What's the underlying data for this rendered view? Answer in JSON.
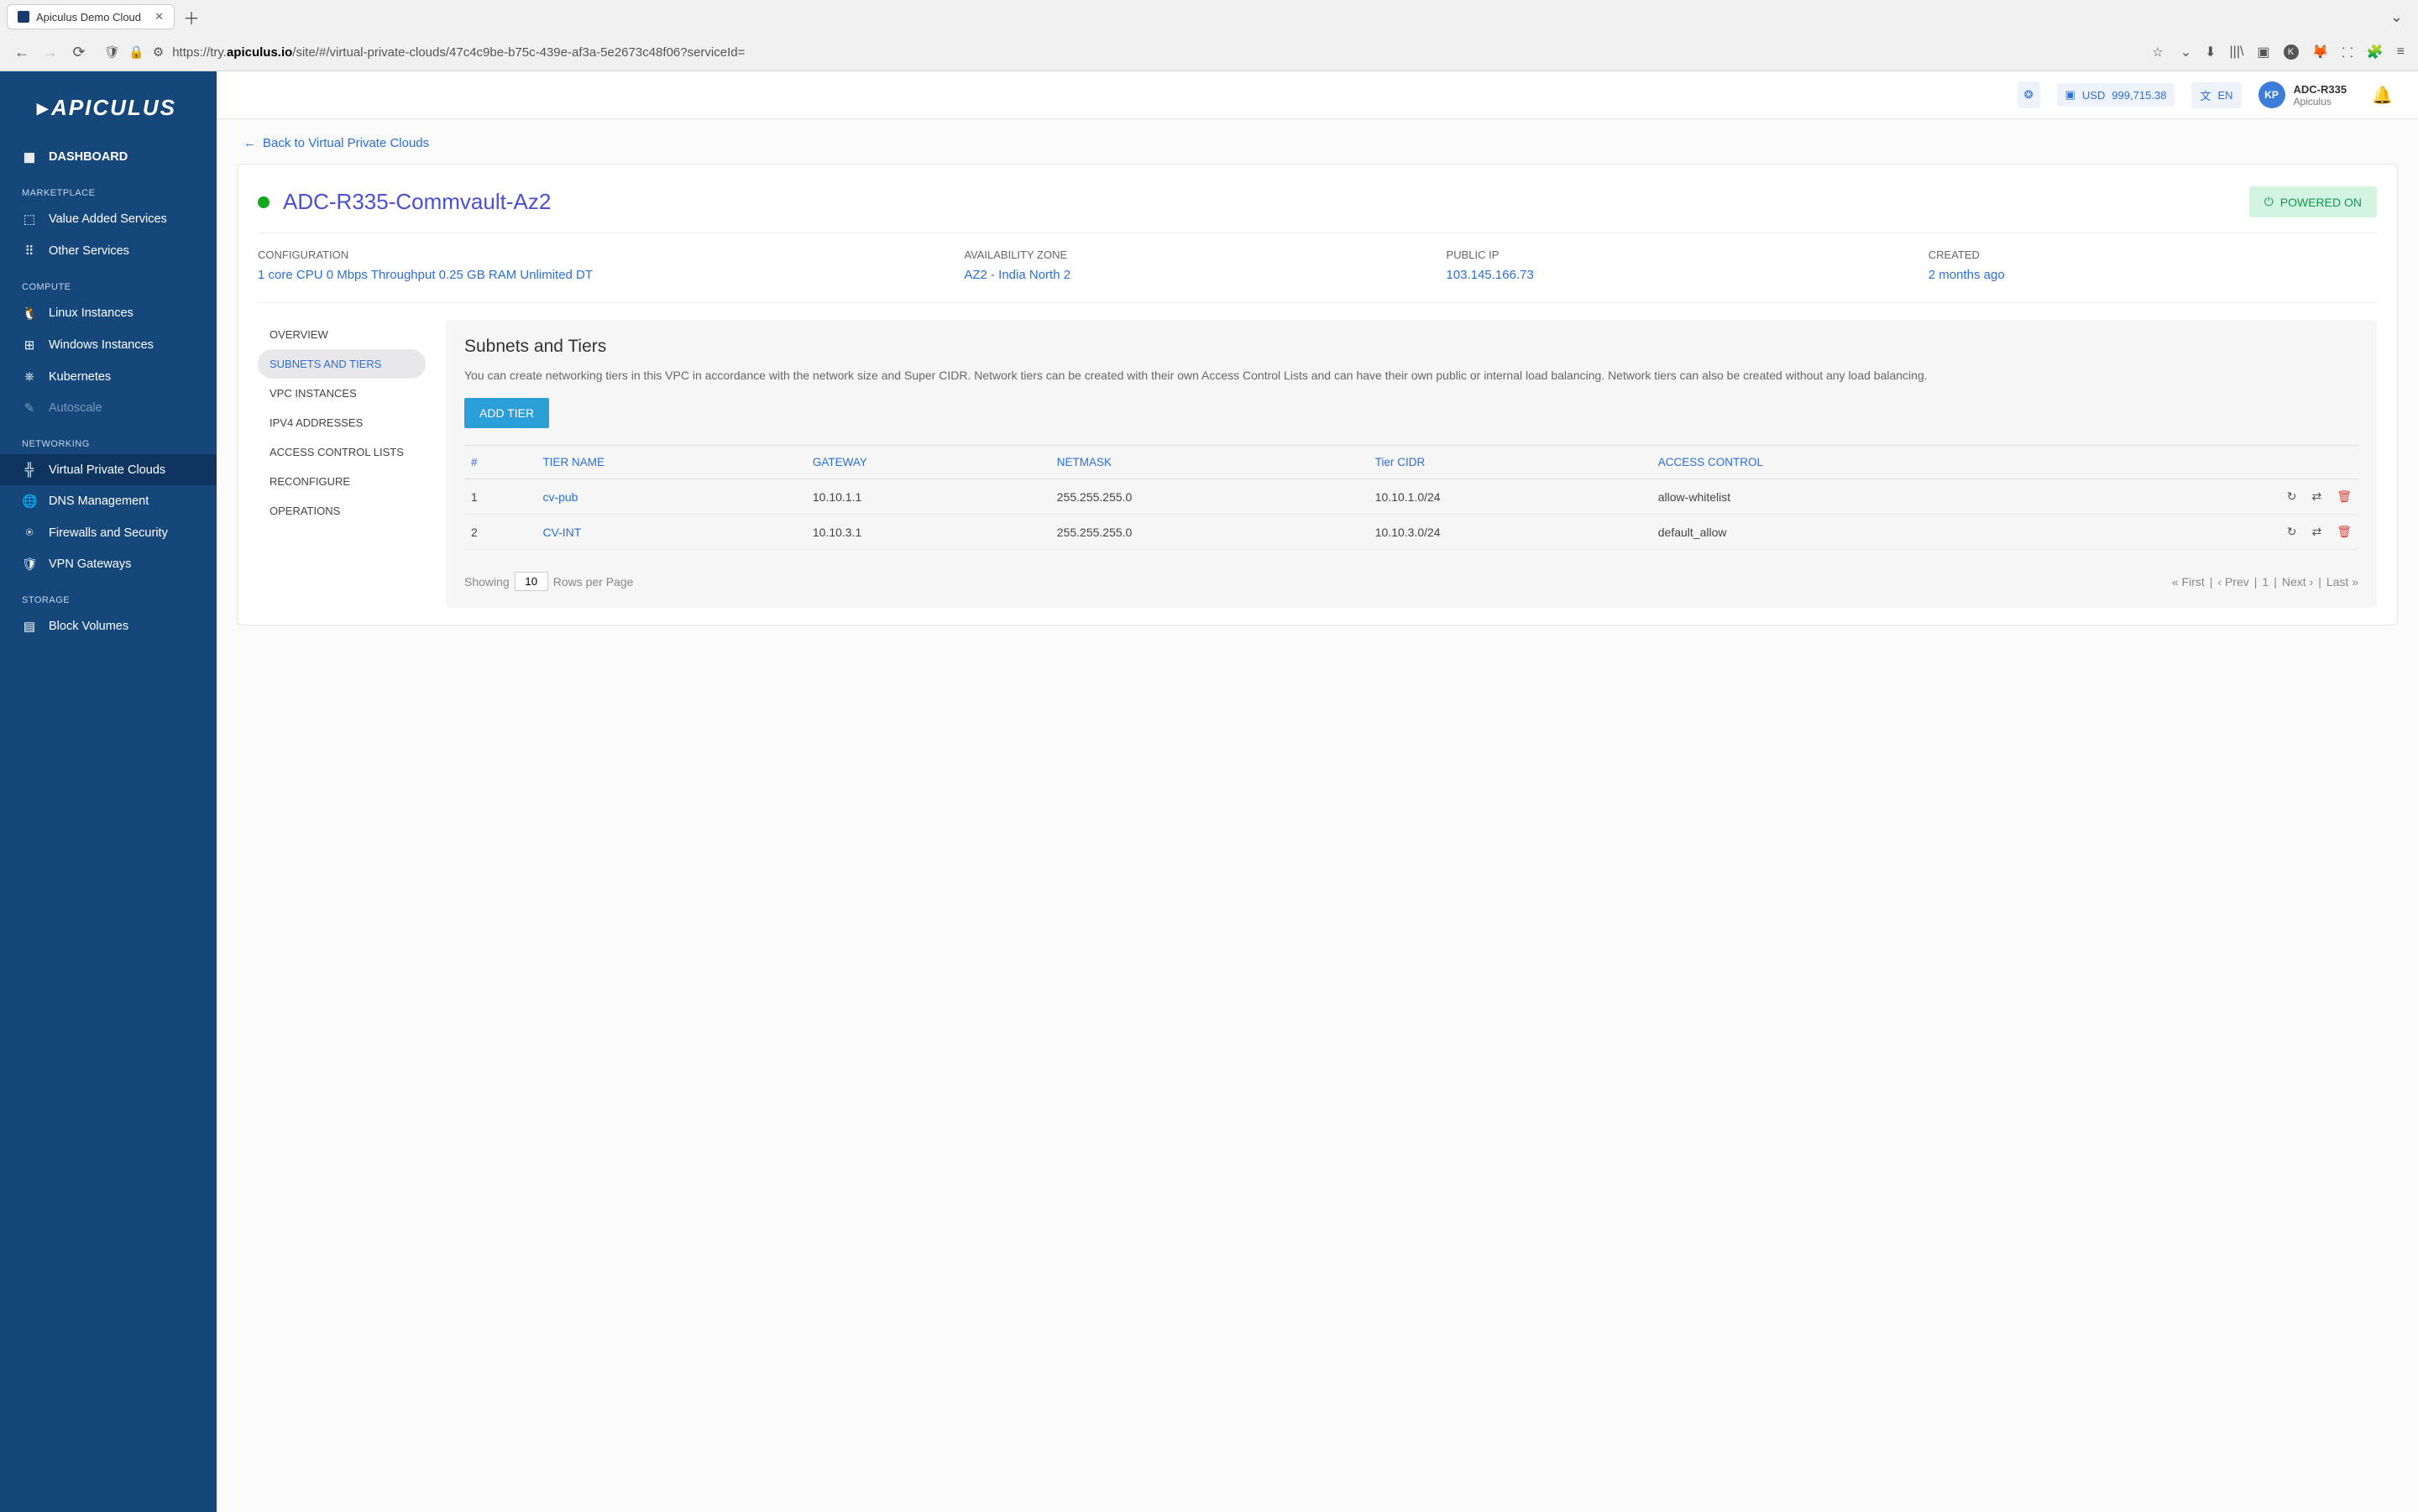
{
  "browser": {
    "tab_title": "Apiculus Demo Cloud",
    "url_prefix": "https://try.",
    "url_domain": "apiculus.io",
    "url_path": "/site/#/virtual-private-clouds/47c4c9be-b75c-439e-af3a-5e2673c48f06?serviceId="
  },
  "header": {
    "balance_currency": "USD",
    "balance_amount": "999,715.38",
    "language": "EN",
    "user_initials": "KP",
    "user_name": "ADC-R335",
    "user_org": "Apiculus"
  },
  "sidebar": {
    "logo": "APICULUS",
    "dashboard": "DASHBOARD",
    "sections": {
      "marketplace": "MARKETPLACE",
      "marketplace_items": [
        "Value Added Services",
        "Other Services"
      ],
      "compute": "COMPUTE",
      "compute_items": [
        "Linux Instances",
        "Windows Instances",
        "Kubernetes",
        "Autoscale"
      ],
      "networking": "NETWORKING",
      "networking_items": [
        "Virtual Private Clouds",
        "DNS Management",
        "Firewalls and Security",
        "VPN Gateways"
      ],
      "storage": "STORAGE",
      "storage_items": [
        "Block Volumes"
      ]
    }
  },
  "backlink": "Back to Virtual Private Clouds",
  "vpc": {
    "title": "ADC-R335-Commvault-Az2",
    "power": "POWERED ON",
    "config_label": "CONFIGURATION",
    "config_value": "1 core CPU 0 Mbps Throughput 0.25 GB RAM Unlimited DT",
    "az_label": "AVAILABILITY ZONE",
    "az_value": "AZ2 - India North 2",
    "ip_label": "PUBLIC IP",
    "ip_value": "103.145.166.73",
    "created_label": "CREATED",
    "created_value": "2 months ago"
  },
  "subnav": [
    "Overview",
    "Subnets and Tiers",
    "VPC Instances",
    "IPv4 Addresses",
    "Access Control Lists",
    "Reconfigure",
    "Operations"
  ],
  "panel": {
    "title": "Subnets and Tiers",
    "desc": "You can create networking tiers in this VPC in accordance with the network size and Super CIDR. Network tiers can be created with their own Access Control Lists and can have their own public or internal load balancing. Network tiers can also be created without any load balancing.",
    "add_button": "ADD TIER",
    "columns": [
      "#",
      "TIER NAME",
      "GATEWAY",
      "NETMASK",
      "Tier CIDR",
      "ACCESS CONTROL"
    ],
    "rows": [
      {
        "n": "1",
        "name": "cv-pub",
        "gateway": "10.10.1.1",
        "netmask": "255.255.255.0",
        "cidr": "10.10.1.0/24",
        "acl": "allow-whitelist"
      },
      {
        "n": "2",
        "name": "CV-INT",
        "gateway": "10.10.3.1",
        "netmask": "255.255.255.0",
        "cidr": "10.10.3.0/24",
        "acl": "default_allow"
      }
    ],
    "pager_showing": "Showing",
    "pager_rows": "10",
    "pager_rpp": "Rows per Page",
    "pager_first": "First",
    "pager_prev": "Prev",
    "pager_page": "1",
    "pager_next": "Next",
    "pager_last": "Last"
  }
}
